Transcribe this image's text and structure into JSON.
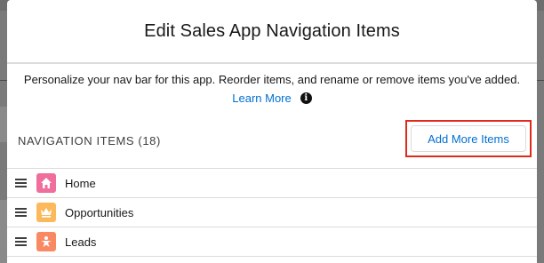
{
  "modal": {
    "title": "Edit Sales App Navigation Items",
    "description_line1": "Personalize your nav bar for this app. Reorder items, and rename or remove items you've added.",
    "learn_more": "Learn More",
    "info_icon": "info-icon",
    "nav_items_header": "NAVIGATION ITEMS (18)",
    "add_more_label": "Add More Items"
  },
  "items": [
    {
      "label": "Home",
      "icon": "home-icon",
      "color": "#ef6e9c"
    },
    {
      "label": "Opportunities",
      "icon": "crown-icon",
      "color": "#fcb95b"
    },
    {
      "label": "Leads",
      "icon": "person-star-icon",
      "color": "#f88962"
    }
  ],
  "colors": {
    "link": "#0070d2",
    "highlight_outline": "#e02a1c",
    "backdrop": "#7a7a7a"
  }
}
